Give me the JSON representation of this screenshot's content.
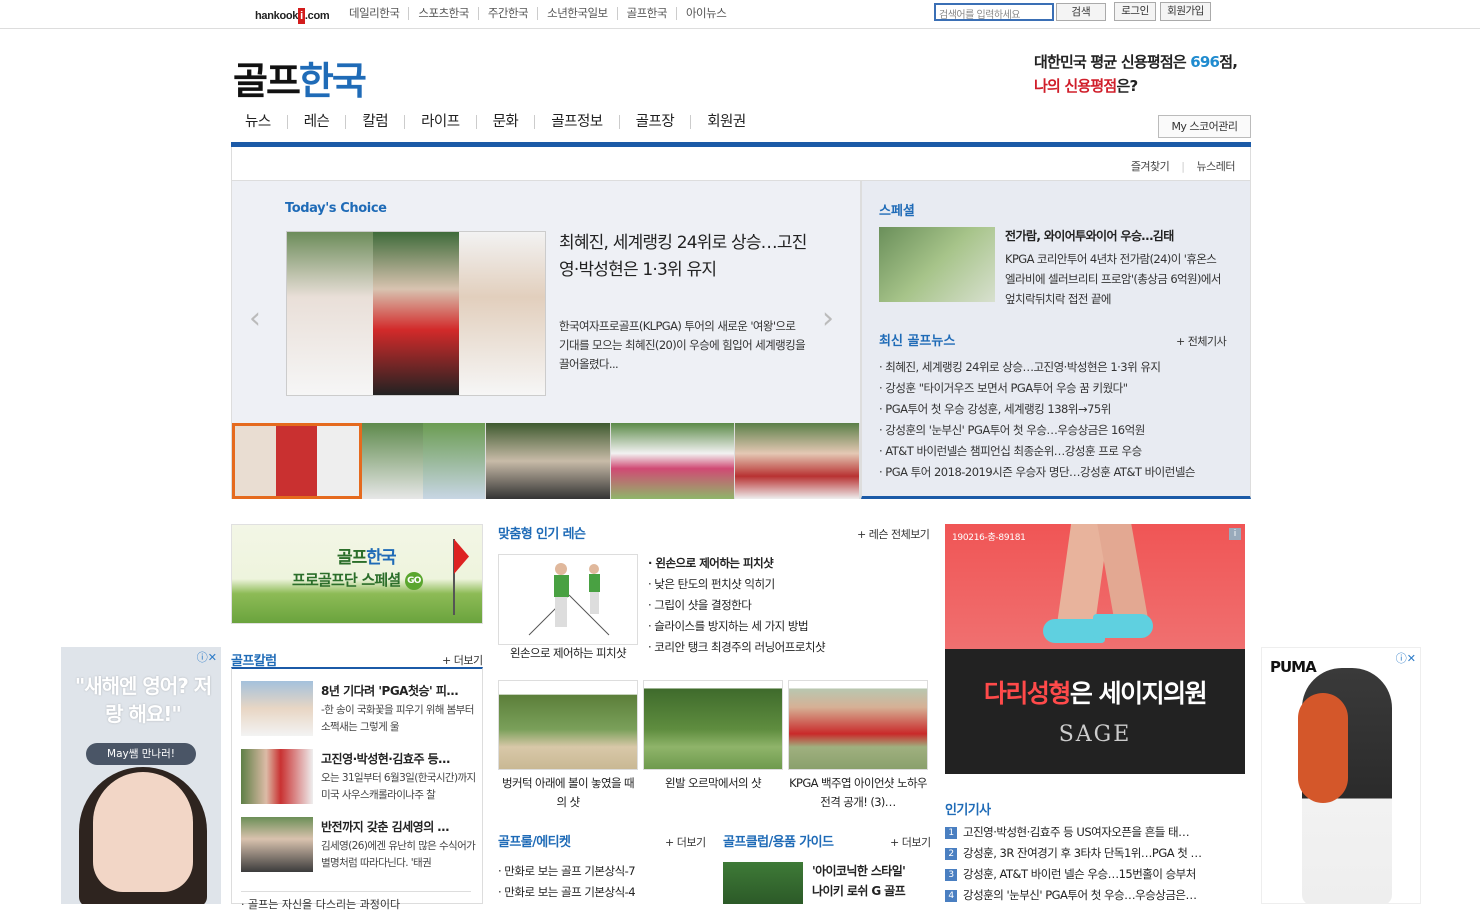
{
  "topbar": {
    "logo_text": "hankook",
    "logo_i": "i",
    "logo_suffix": ".com",
    "sites": [
      "데일리한국",
      "스포츠한국",
      "주간한국",
      "소년한국일보",
      "골프한국",
      "아이뉴스"
    ],
    "search_placeholder": "검색어를 입력하세요",
    "search_button": "검색",
    "login": "로그인",
    "join": "회원가입"
  },
  "header": {
    "logo_a": "골프",
    "logo_b": "한국",
    "credit_line1_a": "대한민국 평균 신용평점은 ",
    "credit_num": "696",
    "credit_line1_b": "점,",
    "credit_line2_a": "나의 신용평점",
    "credit_line2_b": "은?",
    "nav": [
      "뉴스",
      "레슨",
      "칼럼",
      "라이프",
      "문화",
      "골프정보",
      "골프장",
      "회원권"
    ],
    "myscore": "My 스코어관리",
    "favorites": "즐겨찾기",
    "newsletter": "뉴스레터"
  },
  "featured": {
    "label": "Today's Choice",
    "headline": "최혜진, 세계랭킹 24위로 상승…고진영·박성현은 1·3위 유지",
    "desc": "한국여자프로골프(KLPGA) 투어의 새로운 '여왕'으로 기대를 모으는 최혜진(20)이 우승에 힘입어 세계랭킹을 끌어올렸다...",
    "prev_arrow": "‹",
    "next_arrow": "›"
  },
  "special": {
    "title": "스페셜",
    "item_title": "전가람, 와이어투와이어 우승…김태",
    "item_desc": "KPGA 코리안투어 4년차 전가람(24)이 '휴온스 엘라비에 셀러브리티 프로암'(총상금 6억원)에서 엎치락뒤치락 접전 끝에",
    "news_title": "최신 골프뉴스",
    "news_more": "+ 전체기사",
    "news": [
      "· 최혜진, 세계랭킹 24위로 상승…고진영·박성현은 1·3위 유지",
      "· 강성훈 \"타이거우즈 보면서 PGA투어 우승 꿈 키웠다\"",
      "· PGA투어 첫 우승 강성훈, 세계랭킹 138위→75위",
      "· 강성훈의 '눈부신' PGA투어 첫 우승…우승상금은 16억원",
      "· AT&T 바이런넬슨 챔피언십 최종순위…강성훈 프로 우승",
      "· PGA 투어 2018-2019시즌 우승자 명단…강성훈 AT&T 바이런넬슨"
    ]
  },
  "promo": {
    "line1_a": "골프",
    "line1_b": "한국",
    "line2": "프로골프단 스페셜",
    "go": "GO"
  },
  "column": {
    "title": "골프칼럼",
    "more": "+ 더보기",
    "items": [
      {
        "title": "8년 기다려 'PGA첫승' 피…",
        "desc": "-한 송이 국화꽃을 피우기 위해 봄부터 소쩍새는 그렇게 울"
      },
      {
        "title": "고진영·박성현·김효주 등…",
        "desc": "오는 31일부터 6월3일(한국시간)까지 미국 사우스캐롤라이나주 찰"
      },
      {
        "title": "반전까지 갖춘 김세영의 …",
        "desc": "김세영(26)에겐 유난히 많은 수식어가 별명처럼 따라다닌다. '태권"
      }
    ],
    "last": "· 골프는 자신을 다스리는 과정이다"
  },
  "lessons": {
    "title": "맞춤형 인기 레슨",
    "more": "+ 레슨 전체보기",
    "main_caption": "왼손으로 제어하는 피치샷",
    "list": [
      "· 왼손으로 제어하는 피치샷",
      "· 낮은 탄도의 펀치샷 익히기",
      "· 그립이 샷을 결정한다",
      "· 슬라이스를 방지하는 세 가지 방법",
      "· 코리안 탱크 최경주의 러닝어프로치샷"
    ],
    "gallery": [
      {
        "caption": "벙커턱 아래에 볼이 놓였을 때의 샷"
      },
      {
        "caption": "왼발 오르막에서의 샷"
      },
      {
        "caption": "KPGA 백주엽 아이언샷 노하우 전격 공개! (3)…"
      }
    ]
  },
  "rules": {
    "title": "골프룰/에티켓",
    "more": "+ 더보기",
    "list": [
      "· 만화로 보는 골프 기본상식-7",
      "· 만화로 보는 골프 기본상식-4"
    ]
  },
  "club": {
    "title": "골프클럽/용품 가이드",
    "more": "+ 더보기",
    "item_line1": "'아이코닉한 스타일'",
    "item_line2": "나이키 로쉬 G 골프"
  },
  "ad_main": {
    "code": "190216-충-89181",
    "slogan_a": "다리성형",
    "slogan_b": "은 세이지의원",
    "brand": "SAGE"
  },
  "popular": {
    "title": "인기기사",
    "items": [
      {
        "n": "1",
        "text": "고진영·박성현·김효주 등 US여자오픈을 흔들 태…"
      },
      {
        "n": "2",
        "text": "강성훈, 3R 잔여경기 후 3타차 단독1위…PGA 첫 …"
      },
      {
        "n": "3",
        "text": "강성훈, AT&T 바이런 넬슨 우승…15번홀이 승부처"
      },
      {
        "n": "4",
        "text": "강성훈의 '눈부신' PGA투어 첫 우승…우승상금은…"
      }
    ]
  },
  "side_ad_left": {
    "quote": "\"새해엔 영어? 저랑 해요!\"",
    "button": "May쌤 만나러!"
  },
  "side_ad_right": {
    "brand": "PUMA"
  }
}
